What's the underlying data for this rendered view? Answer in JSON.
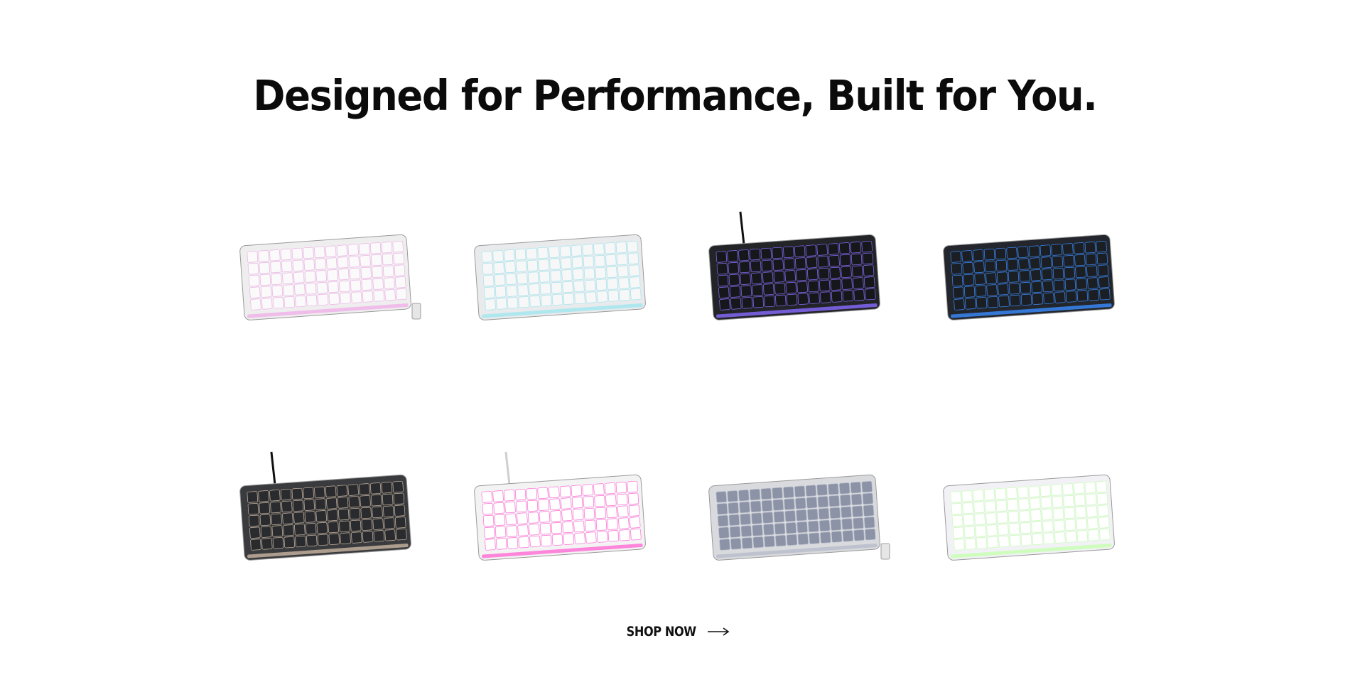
{
  "section": {
    "title": "Designed for Performance, Built for You."
  },
  "products": [
    {
      "icon": "white-rgb-tkl-keyboard-icon",
      "body": "#eeeeee",
      "keys": "#fafafa",
      "glow": "#f0b0e8",
      "cable": false,
      "dongle": true
    },
    {
      "icon": "white-compact-keyboard-icon",
      "body": "#e8eaec",
      "keys": "#f7f7f7",
      "glow": "#a0e6f0",
      "cable": false,
      "dongle": false
    },
    {
      "icon": "black-tkl-keyboard-icon",
      "body": "#222428",
      "keys": "#16171a",
      "glow": "#8a6cff",
      "cable": true,
      "dongle": false
    },
    {
      "icon": "black-blue-led-keyboard-icon",
      "body": "#23272d",
      "keys": "#1b1e22",
      "glow": "#3a8cff",
      "cable": false,
      "dongle": false
    },
    {
      "icon": "black-beige-65-keyboard-icon",
      "body": "#3a3b3e",
      "keys": "#2a2b2e",
      "glow": "#c9b7a3",
      "cable": true,
      "dongle": false
    },
    {
      "icon": "white-rgb-60-keyboard-icon",
      "body": "#f3f3f3",
      "keys": "#ffffff",
      "glow": "#ff6ad5",
      "cable": true,
      "dongle": false
    },
    {
      "icon": "grey-knob-keyboard-icon",
      "body": "#d9dadd",
      "keys": "#8c93a6",
      "glow": "#b6bccb",
      "cable": false,
      "dongle": true
    },
    {
      "icon": "white-rgb-65-keyboard-icon",
      "body": "#f2f2f6",
      "keys": "#ffffff",
      "glow": "#c5ffb0",
      "cable": false,
      "dongle": false
    }
  ],
  "cta": {
    "label": "SHOP NOW",
    "icon": "arrow-right-icon"
  }
}
